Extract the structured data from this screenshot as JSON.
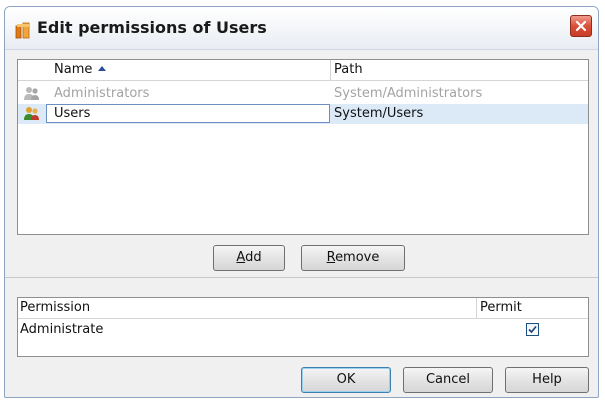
{
  "window": {
    "title": "Edit permissions of Users"
  },
  "user_list": {
    "columns": [
      "Name",
      "Path"
    ],
    "sort_column": "Name",
    "rows": [
      {
        "name": "Administrators",
        "path": "System/Administrators",
        "state": "disabled"
      },
      {
        "name": "Users",
        "path": "System/Users",
        "state": "selected"
      }
    ]
  },
  "list_buttons": {
    "add": {
      "mnemonic": "A",
      "rest": "dd"
    },
    "remove": {
      "mnemonic": "R",
      "rest": "emove"
    }
  },
  "permissions": {
    "columns": [
      "Permission",
      "Permit"
    ],
    "rows": [
      {
        "permission": "Administrate",
        "permit": true
      }
    ]
  },
  "footer_buttons": {
    "ok": "OK",
    "cancel": "Cancel",
    "help": "Help"
  },
  "icons": {
    "title": "folder-key-icon",
    "close": "close-icon",
    "group_disabled": "user-group-icon",
    "group_active": "user-group-icon",
    "sort": "sort-ascending-icon",
    "check": "checkmark-icon"
  },
  "colors": {
    "close_button": "#d9503b",
    "selection": "#dce9f7",
    "sort_arrow": "#2b4f9a"
  }
}
